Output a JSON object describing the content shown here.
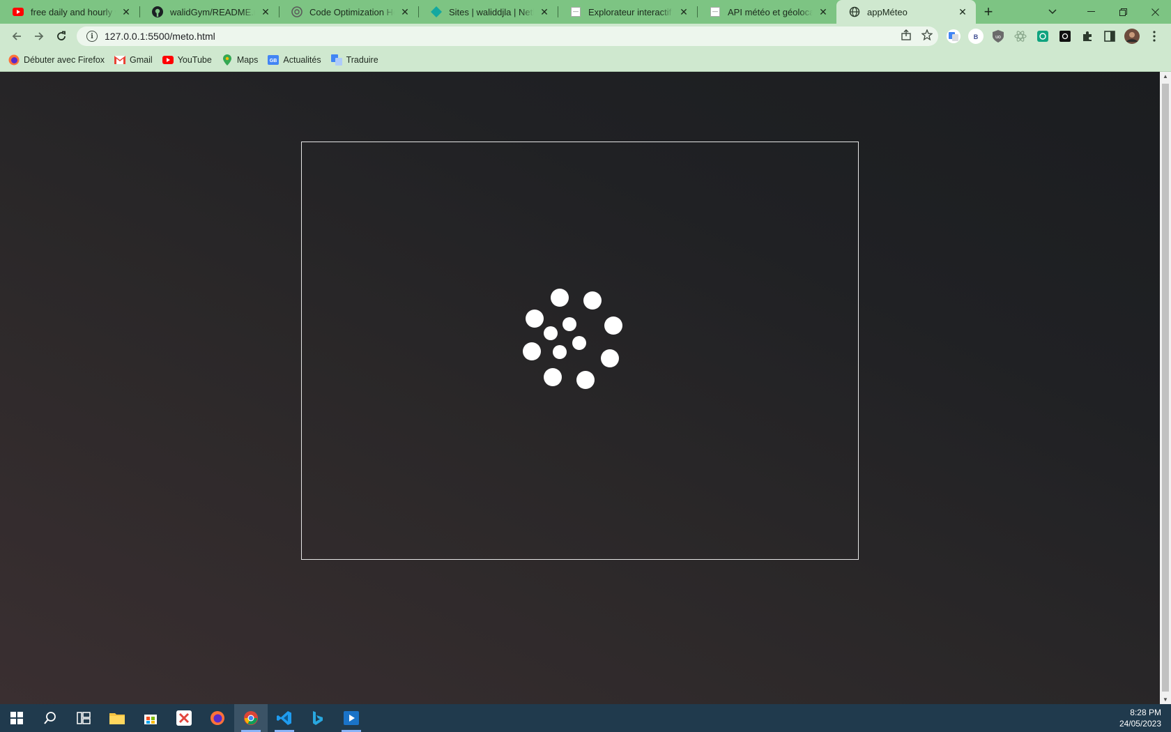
{
  "tabs": [
    {
      "title": "free daily and hourly weather",
      "icon": "youtube-icon"
    },
    {
      "title": "walidGym/README.md at main",
      "icon": "github-icon"
    },
    {
      "title": "Code Optimization Help",
      "icon": "openai-icon"
    },
    {
      "title": "Sites | waliddjla | Netlify",
      "icon": "netlify-icon"
    },
    {
      "title": "Explorateur interactif de l'API",
      "icon": "page-icon"
    },
    {
      "title": "API météo et géolocalisation",
      "icon": "page-icon"
    },
    {
      "title": "appMéteo",
      "icon": "globe-icon",
      "active": true
    }
  ],
  "address": {
    "url": "127.0.0.1:5500/meto.html"
  },
  "bookmarks": [
    {
      "label": "Débuter avec Firefox",
      "icon": "firefox-icon"
    },
    {
      "label": "Gmail",
      "icon": "gmail-icon"
    },
    {
      "label": "YouTube",
      "icon": "youtube-icon"
    },
    {
      "label": "Maps",
      "icon": "maps-icon"
    },
    {
      "label": "Actualités",
      "icon": "news-icon"
    },
    {
      "label": "Traduire",
      "icon": "translate-icon"
    }
  ],
  "extensions": [
    "google-translate-icon",
    "b-extension-icon",
    "ublock-icon",
    "react-devtools-icon",
    "chatgpt-icon",
    "dark-extension-icon",
    "puzzle-icon",
    "sidepanel-icon",
    "profile-avatar-icon",
    "kebab-menu-icon"
  ],
  "loader": {
    "state": "loading",
    "dot_color": "#ffffff"
  },
  "taskbar": {
    "apps": [
      "start-icon",
      "search-icon",
      "task-view-icon",
      "file-explorer-icon",
      "store-icon",
      "xampp-icon",
      "firefox-icon",
      "chrome-icon",
      "vscode-icon",
      "bing-icon",
      "media-player-icon"
    ],
    "time": "8:28 PM",
    "date": "24/05/2023"
  },
  "colors": {
    "tabstrip": "#7dc483",
    "toolbar": "#cfe8cf",
    "page_bg": "#202124",
    "taskbar": "#203a4d"
  }
}
